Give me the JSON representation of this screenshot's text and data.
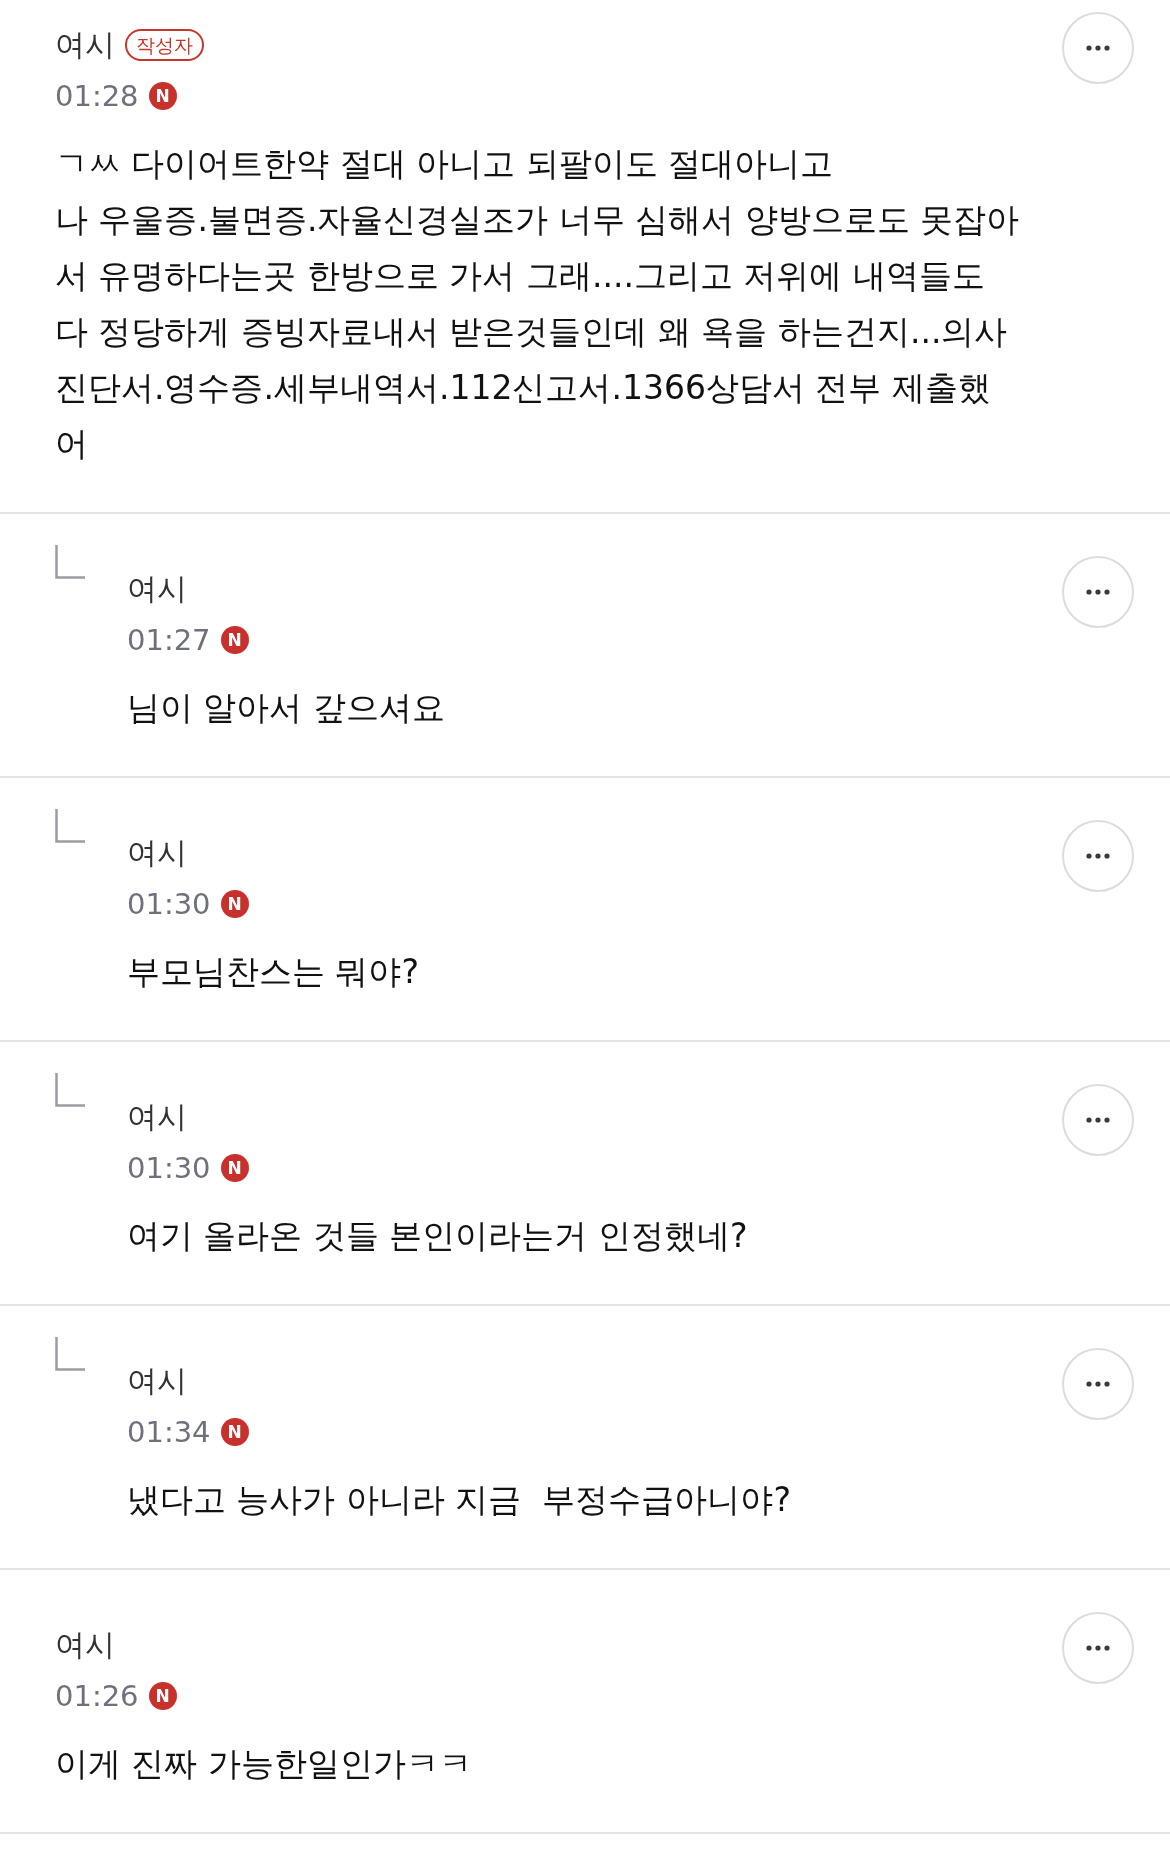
{
  "comments": [
    {
      "kind": "top",
      "author": "여시",
      "badge": "작성자",
      "time": "01:28",
      "new_badge": "N",
      "body": "ㄱㅆ 다이어트한약 절대 아니고 되팔이도 절대아니고\n나 우울증.불면증.자율신경실조가 너무 심해서 양방으로도 못잡아\n서 유명하다는곳 한방으로 가서 그래....그리고 저위에 내역들도\n다 정당하게 증빙자료내서 받은것들인데 왜 욕을 하는건지...의사\n진단서.영수증.세부내역서.112신고서.1366상담서 전부 제출했\n어"
    },
    {
      "kind": "reply",
      "author": "여시",
      "time": "01:27",
      "new_badge": "N",
      "body": "님이 알아서 갚으셔요"
    },
    {
      "kind": "reply",
      "author": "여시",
      "time": "01:30",
      "new_badge": "N",
      "body": "부모님찬스는 뭐야?"
    },
    {
      "kind": "reply",
      "author": "여시",
      "time": "01:30",
      "new_badge": "N",
      "body": "여기 올라온 것들 본인이라는거 인정했네?"
    },
    {
      "kind": "reply",
      "author": "여시",
      "time": "01:34",
      "new_badge": "N",
      "body": "냈다고 능사가 아니라 지금  부정수급아니야?"
    },
    {
      "kind": "top",
      "author": "여시",
      "time": "01:26",
      "new_badge": "N",
      "body": "이게 진짜 가능한일인가ㅋㅋ"
    }
  ]
}
